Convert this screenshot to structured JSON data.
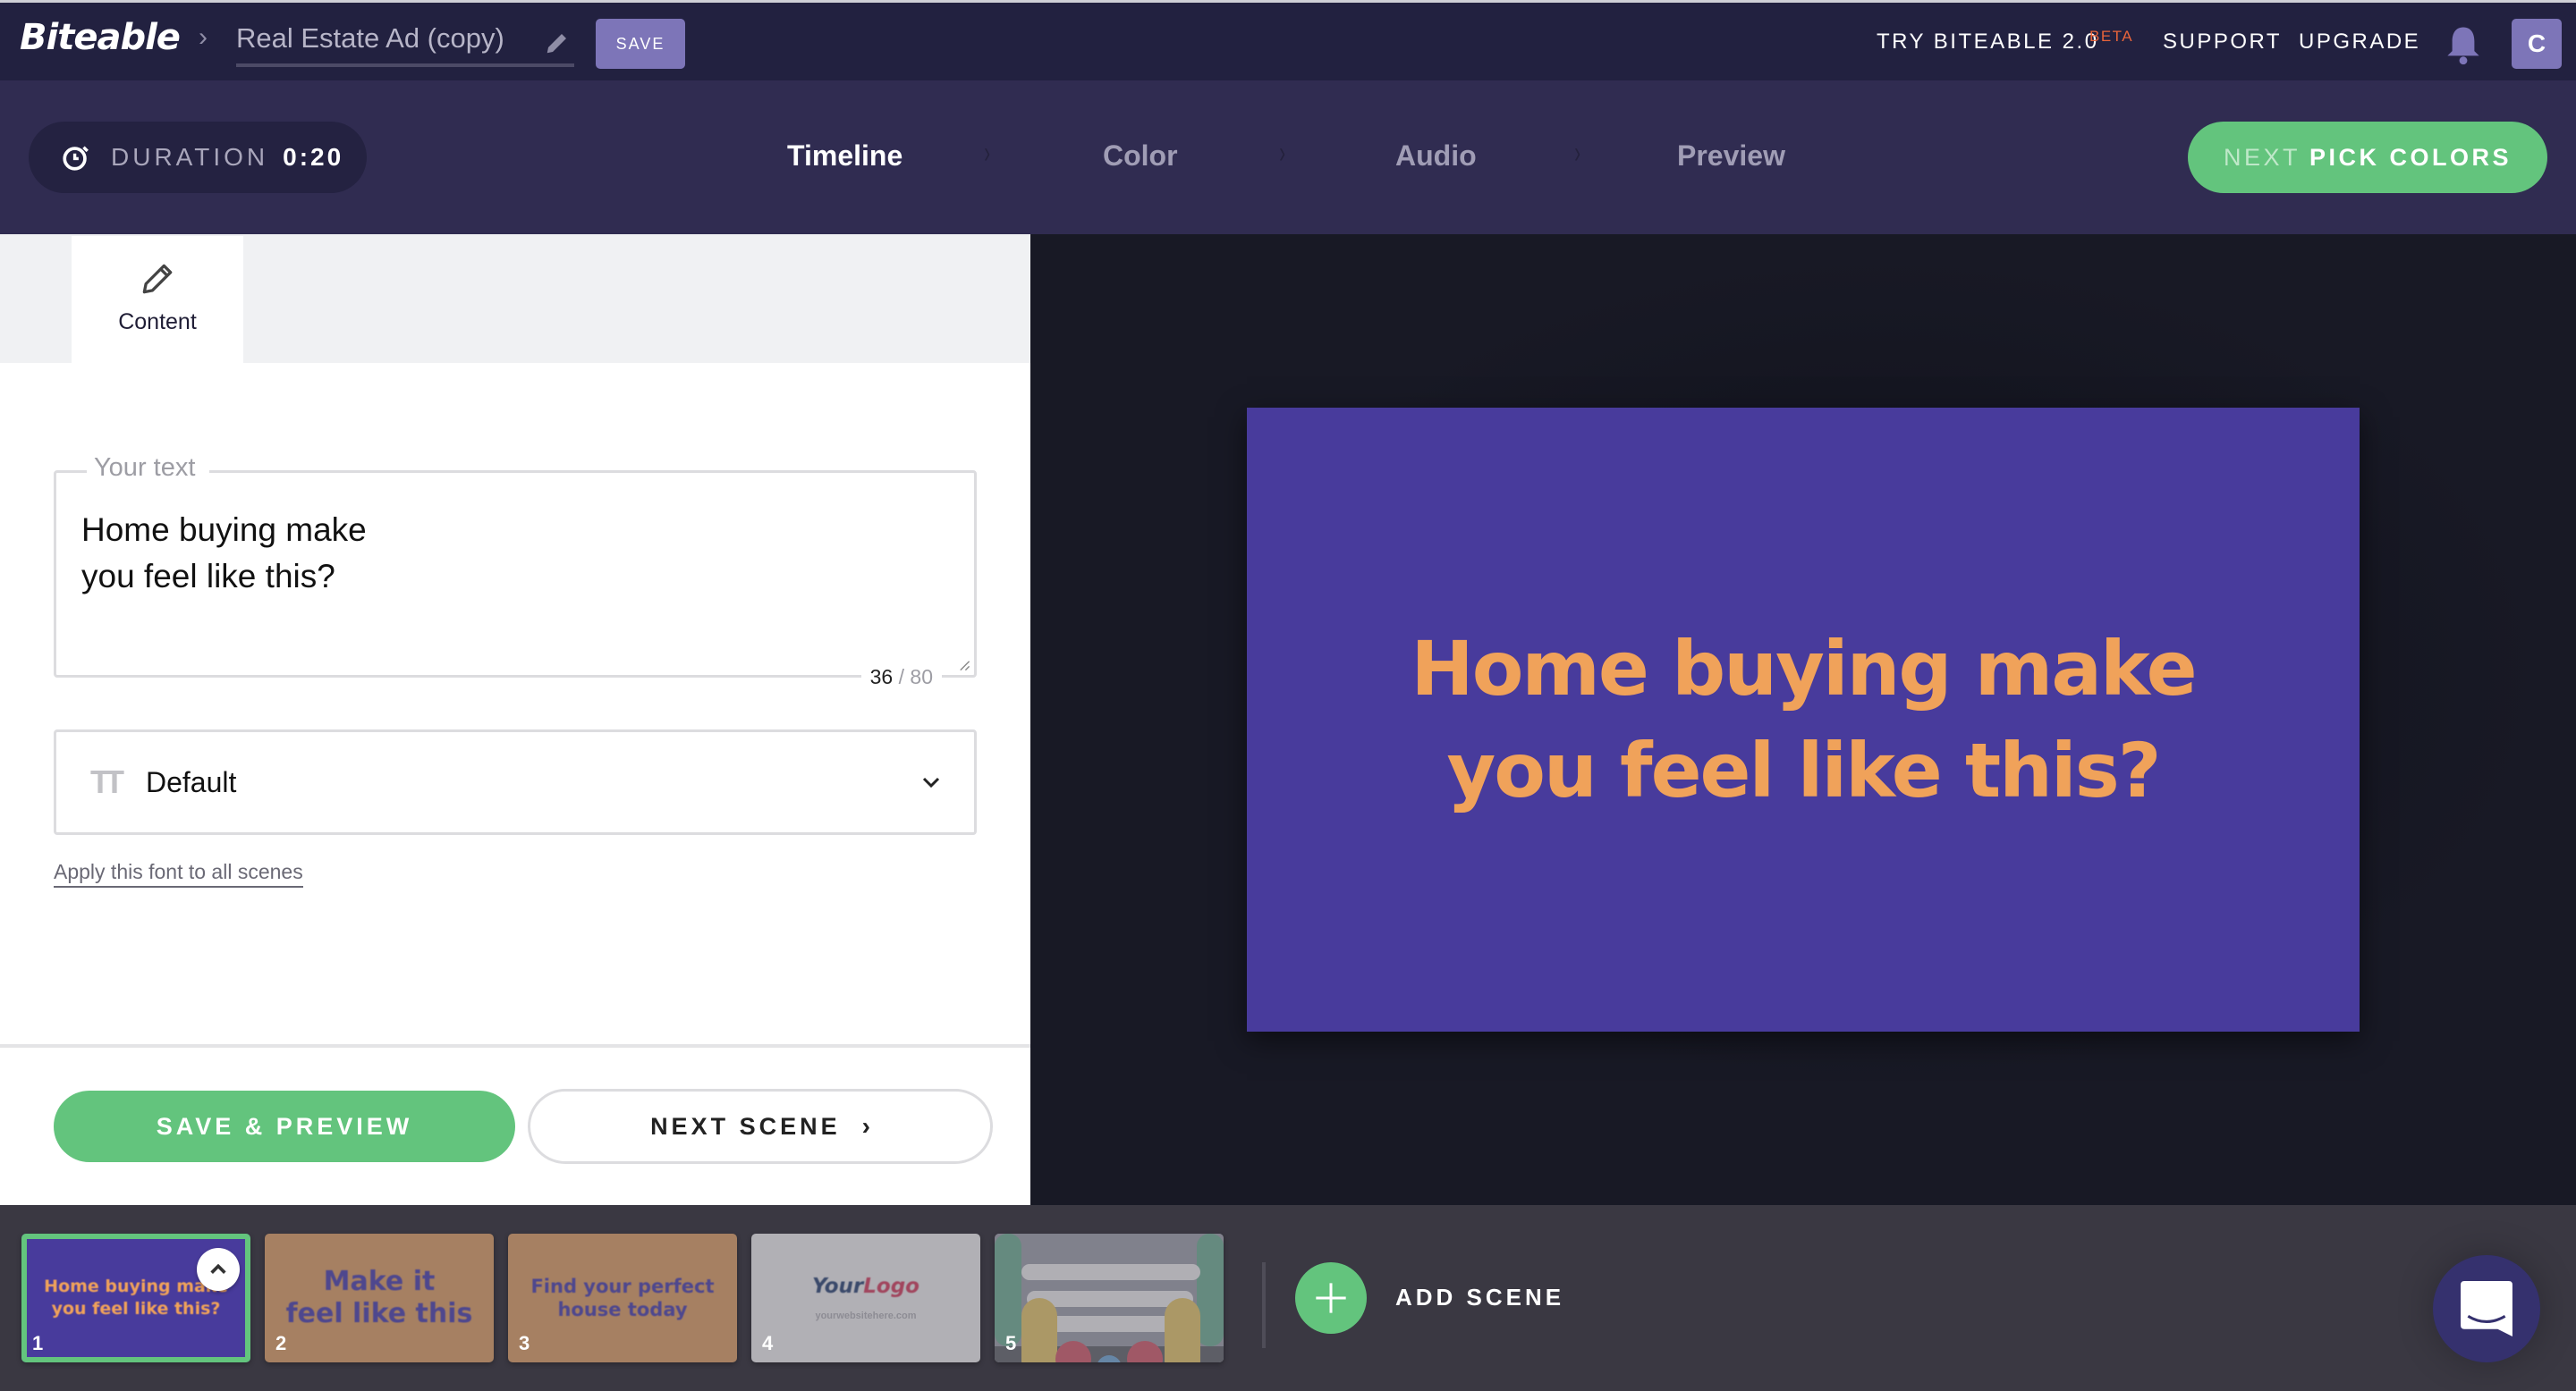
{
  "header": {
    "logo": "Biteable",
    "breadcrumb_separator": "›",
    "project_title": "Real Estate Ad (copy)",
    "save_label": "SAVE",
    "try_label": "TRY BITEABLE 2.0",
    "beta_label": "BETA",
    "support_label": "SUPPORT",
    "upgrade_label": "UPGRADE",
    "avatar_initial": "C",
    "icons": {
      "edit": "pencil-icon",
      "notifications": "bell-icon"
    }
  },
  "stepbar": {
    "duration_label": "DURATION",
    "duration_value": "0:20",
    "steps": [
      {
        "label": "Timeline",
        "active": true
      },
      {
        "label": "Color",
        "active": false
      },
      {
        "label": "Audio",
        "active": false
      },
      {
        "label": "Preview",
        "active": false
      }
    ],
    "step_separator": "›",
    "next_button": {
      "prefix": "NEXT",
      "label": "PICK COLORS"
    }
  },
  "editor": {
    "tabs": [
      {
        "label": "Content",
        "icon": "pencil-icon",
        "active": true
      }
    ],
    "text_field": {
      "label": "Your text",
      "value": "Home buying make\nyou feel like this?",
      "char_count": "36",
      "char_max": "/ 80"
    },
    "font_select": {
      "icon": "text-size-icon",
      "icon_glyph": "TT",
      "value": "Default"
    },
    "apply_font_link": "Apply this font to all scenes",
    "save_preview_label": "SAVE & PREVIEW",
    "next_scene_label": "NEXT SCENE",
    "next_scene_arrow": "›"
  },
  "preview": {
    "canvas_text": "Home buying make\nyou feel like this?",
    "background_color": "#483b9c",
    "text_color": "#f0a25a"
  },
  "filmstrip": {
    "scenes": [
      {
        "number": "1",
        "text": "Home buying make\nyou feel like this?",
        "bg": "#483b9c",
        "fg": "#f0a25a",
        "selected": true
      },
      {
        "number": "2",
        "text": "Make it\nfeel like this",
        "bg": "#a68062",
        "fg": "#4e478e",
        "selected": false
      },
      {
        "number": "3",
        "text": "Find your perfect\nhouse today",
        "bg": "#a68062",
        "fg": "#4e478e",
        "selected": false
      },
      {
        "number": "4",
        "logo_your": "Your",
        "logo_logo": "Logo",
        "website": "yourwebsitehere.com",
        "bg": "#b1b0b5",
        "selected": false
      },
      {
        "number": "5",
        "bg": "#80818c",
        "selected": false
      }
    ],
    "add_scene_label": "ADD SCENE"
  },
  "colors": {
    "accent_green": "#63c47d",
    "brand_purple": "#7d75b8",
    "topbar": "#222140",
    "stepbar": "#302c51"
  }
}
